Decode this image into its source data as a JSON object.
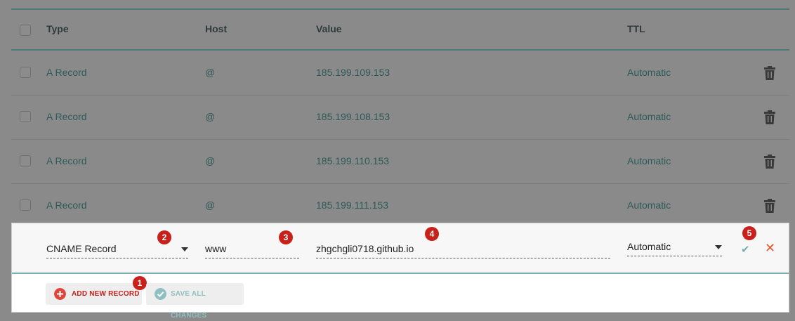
{
  "header": {
    "type": "Type",
    "host": "Host",
    "value": "Value",
    "ttl": "TTL"
  },
  "records": [
    {
      "type": "A Record",
      "host": "@",
      "value": "185.199.109.153",
      "ttl": "Automatic"
    },
    {
      "type": "A Record",
      "host": "@",
      "value": "185.199.108.153",
      "ttl": "Automatic"
    },
    {
      "type": "A Record",
      "host": "@",
      "value": "185.199.110.153",
      "ttl": "Automatic"
    },
    {
      "type": "A Record",
      "host": "@",
      "value": "185.199.111.153",
      "ttl": "Automatic"
    }
  ],
  "new_record": {
    "type": "CNAME Record",
    "host": "www",
    "value": "zhgchgli0718.github.io",
    "ttl": "Automatic"
  },
  "actions": {
    "add_new_record": "ADD NEW RECORD",
    "save_all_changes": "SAVE ALL CHANGES"
  },
  "annotations": [
    "1",
    "2",
    "3",
    "4",
    "5"
  ],
  "colors": {
    "accent_teal": "#7aaeb0",
    "record_text": "#2d5a57",
    "badge_red": "#c8211b",
    "close_orange": "#e8562a"
  },
  "icons": {
    "delete": "trash-icon",
    "add": "plus-circle-icon",
    "save": "check-circle-icon",
    "confirm": "check-icon",
    "cancel": "close-icon",
    "dropdown": "chevron-down-icon"
  }
}
